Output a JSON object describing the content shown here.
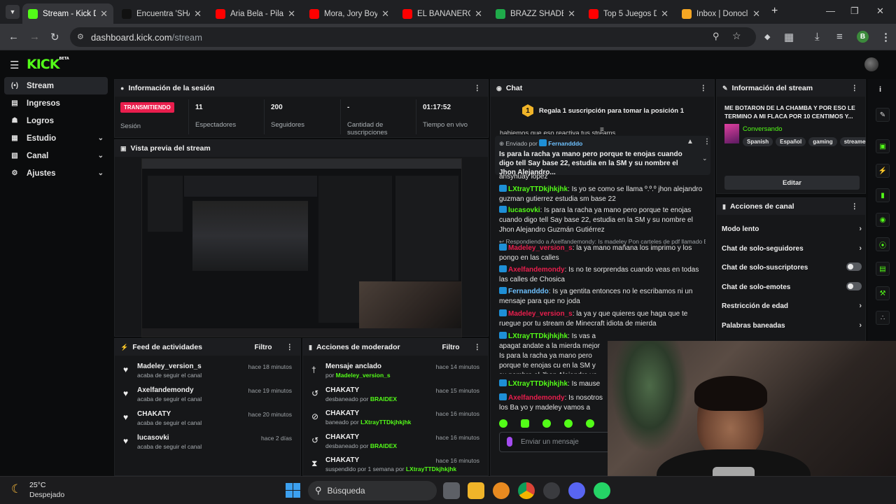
{
  "browser": {
    "tabs": [
      {
        "title": "Stream - Kick Da",
        "favicon": "kick",
        "color": "#53fc18",
        "active": true
      },
      {
        "title": "Encuentra 'SHAD",
        "favicon": "tiktok",
        "color": "#111111"
      },
      {
        "title": "Aria Bela - Pilate",
        "favicon": "youtube",
        "color": "#ff0000"
      },
      {
        "title": "Mora, Jory Boy -",
        "favicon": "youtube",
        "color": "#ff0000"
      },
      {
        "title": "EL BANANERO -",
        "favicon": "youtube",
        "color": "#ff0000"
      },
      {
        "title": "BRAZZ SHADER",
        "favicon": "sheets",
        "color": "#1faa4a"
      },
      {
        "title": "Top 5 Juegos De",
        "favicon": "youtube",
        "color": "#ff0000"
      },
      {
        "title": "Inbox | Donoclip",
        "favicon": "donoclip",
        "color": "#f5a623"
      }
    ],
    "url_host": "dashboard.kick.com",
    "url_path": "/stream",
    "profile_initial": "B"
  },
  "kick": {
    "logo": "KICK",
    "logo_sup": "BETA",
    "sidebar": [
      {
        "label": "Stream",
        "icon": "broadcast-icon",
        "active": true
      },
      {
        "label": "Ingresos",
        "icon": "wallet-icon"
      },
      {
        "label": "Logros",
        "icon": "trophy-icon"
      },
      {
        "label": "Estudio",
        "icon": "studio-icon",
        "expandable": true
      },
      {
        "label": "Canal",
        "icon": "channel-icon",
        "expandable": true
      },
      {
        "label": "Ajustes",
        "icon": "gear-icon",
        "expandable": true
      }
    ],
    "session": {
      "title": "Información de la sesión",
      "live_badge": "TRANSMITIENDO",
      "session_label": "Sesión",
      "viewers": "11",
      "viewers_label": "Espectadores",
      "followers": "200",
      "followers_label": "Seguidores",
      "subs": "-",
      "subs_label": "Cantidad de suscripciones",
      "time": "01:17:52",
      "time_label": "Tiempo en vivo"
    },
    "preview_title": "Vista previa del stream",
    "activity": {
      "title": "Feed de actividades",
      "filter": "Filtro",
      "items": [
        {
          "name": "Madeley_version_s",
          "sub": "acaba de seguir el canal",
          "time": "hace 18 minutos"
        },
        {
          "name": "Axelfandemondy",
          "sub": "acaba de seguir el canal",
          "time": "hace 19 minutos"
        },
        {
          "name": "CHAKATY",
          "sub": "acaba de seguir el canal",
          "time": "hace 20 minutos"
        },
        {
          "name": "lucasovki",
          "sub": "acaba de seguir el canal",
          "time": "hace 2 días"
        }
      ]
    },
    "modactions": {
      "title": "Acciones de moderador",
      "filter": "Filtro",
      "items": [
        {
          "icon": "pin-icon",
          "name": "Mensaje anclado",
          "pre": "por",
          "by": "Madeley_version_s",
          "time": "hace 14 minutos"
        },
        {
          "icon": "unban-icon",
          "name": "CHAKATY",
          "pre": "desbaneado por",
          "by": "BRAIDEX",
          "time": "hace 15 minutos"
        },
        {
          "icon": "ban-icon",
          "name": "CHAKATY",
          "pre": "baneado por",
          "by": "LXtrayTTDkjhkjhk",
          "time": "hace 16 minutos"
        },
        {
          "icon": "unban-icon",
          "name": "CHAKATY",
          "pre": "desbaneado por",
          "by": "BRAIDEX",
          "time": "hace 16 minutos"
        },
        {
          "icon": "timeout-icon",
          "name": "CHAKATY",
          "pre": "suspendido por 1 semana por",
          "by": "LXtrayTTDkjhkjhk",
          "time": "hace 16 minutos"
        }
      ]
    },
    "chat": {
      "title": "Chat",
      "gift_rank": "1",
      "gift_text": "Regala 1 suscripción para tomar la posición 1",
      "scroll_partial": "habiemos que eso reactiva tus streams",
      "pinned_label": "Enviado por",
      "pinned_by": "Fernandddo",
      "pinned_text": "Is para la racha ya mano pero porque te enojas cuando digo tell Say base 22, estudia en la SM y su nombre el Jhon Alejandro...",
      "reply_note": "Respondiendo a Axelfandemondy: Is madeley Pon carteles de pdf llamado Br...",
      "input_placeholder": "Enviar un mensaje",
      "messages": [
        {
          "user": "",
          "text": "ansyhuay lopez",
          "color": "#e4e4e4"
        },
        {
          "user": "LXtrayTTDkjhkjhk",
          "text": ": Is yo se como se llama º.º.º jhon alejandro guzman gutierrez estudia sm base 22",
          "color": "#53fc18"
        },
        {
          "user": "lucasovki",
          "text": ": Is para la racha ya mano pero porque te enojas cuando digo tell Say base 22, estudia en la SM y su nombre el Jhon Alejandro Guzmán Gutiérrez",
          "color": "#53fc18"
        },
        {
          "user": "Madeley_version_s",
          "text": ": la ya mano mañana los imprimo y los pongo en las calles",
          "color": "#e91e4d"
        },
        {
          "user": "Axelfandemondy",
          "text": ": Is no te sorprendas cuando veas en todas las calles de Chosica",
          "color": "#e91e4d"
        },
        {
          "user": "Fernandddo",
          "text": ": Is ya gentita entonces no le escribamos ni un mensaje para que no joda",
          "color": "#6ec1ff"
        },
        {
          "user": "Madeley_version_s",
          "text": ": la ya y que quieres que haga que te ruegue por tu stream de Minecraft idiota de mierda",
          "color": "#e91e4d"
        },
        {
          "user": "LXtrayTTDkjhkjhk",
          "text": ": Is vas a apagat andate a la mierda mejor Is para la racha ya mano pero porque te enojas cu en la SM y su nombre el Jhon Alejandro ya mano pero porque te enojas cuando en la SM y su nombre el Jhon Alejandro Guzm",
          "color": "#53fc18"
        },
        {
          "user": "LXtrayTTDkjhkjhk",
          "text": ": Is mause vas a te",
          "color": "#53fc18"
        },
        {
          "user": "Axelfandemondy",
          "text": ": Is nosotros los Ba yo y madeley vamos a poner carteles en",
          "color": "#e91e4d"
        }
      ]
    },
    "stream_info": {
      "title": "Información del stream",
      "stream_title": "ME BOTARON DE LA CHAMBA Y POR ESO LE TERMINO A MI FLACA POR 10 CENTIMOS Y...",
      "category": "Conversando",
      "tags": [
        "Spanish",
        "Español",
        "gaming",
        "streamer"
      ],
      "edit": "Editar"
    },
    "channel_actions": {
      "title": "Acciones de canal",
      "items": [
        {
          "label": "Modo lento",
          "kind": "chevron"
        },
        {
          "label": "Chat de solo-seguidores",
          "kind": "chevron"
        },
        {
          "label": "Chat de solo-suscriptores",
          "kind": "toggle"
        },
        {
          "label": "Chat de solo-emotes",
          "kind": "toggle"
        },
        {
          "label": "Restricción de edad",
          "kind": "chevron"
        },
        {
          "label": "Palabras baneadas",
          "kind": "chevron"
        }
      ]
    }
  },
  "taskbar": {
    "temp": "25°C",
    "weather": "Despejado",
    "search": "Búsqueda"
  }
}
